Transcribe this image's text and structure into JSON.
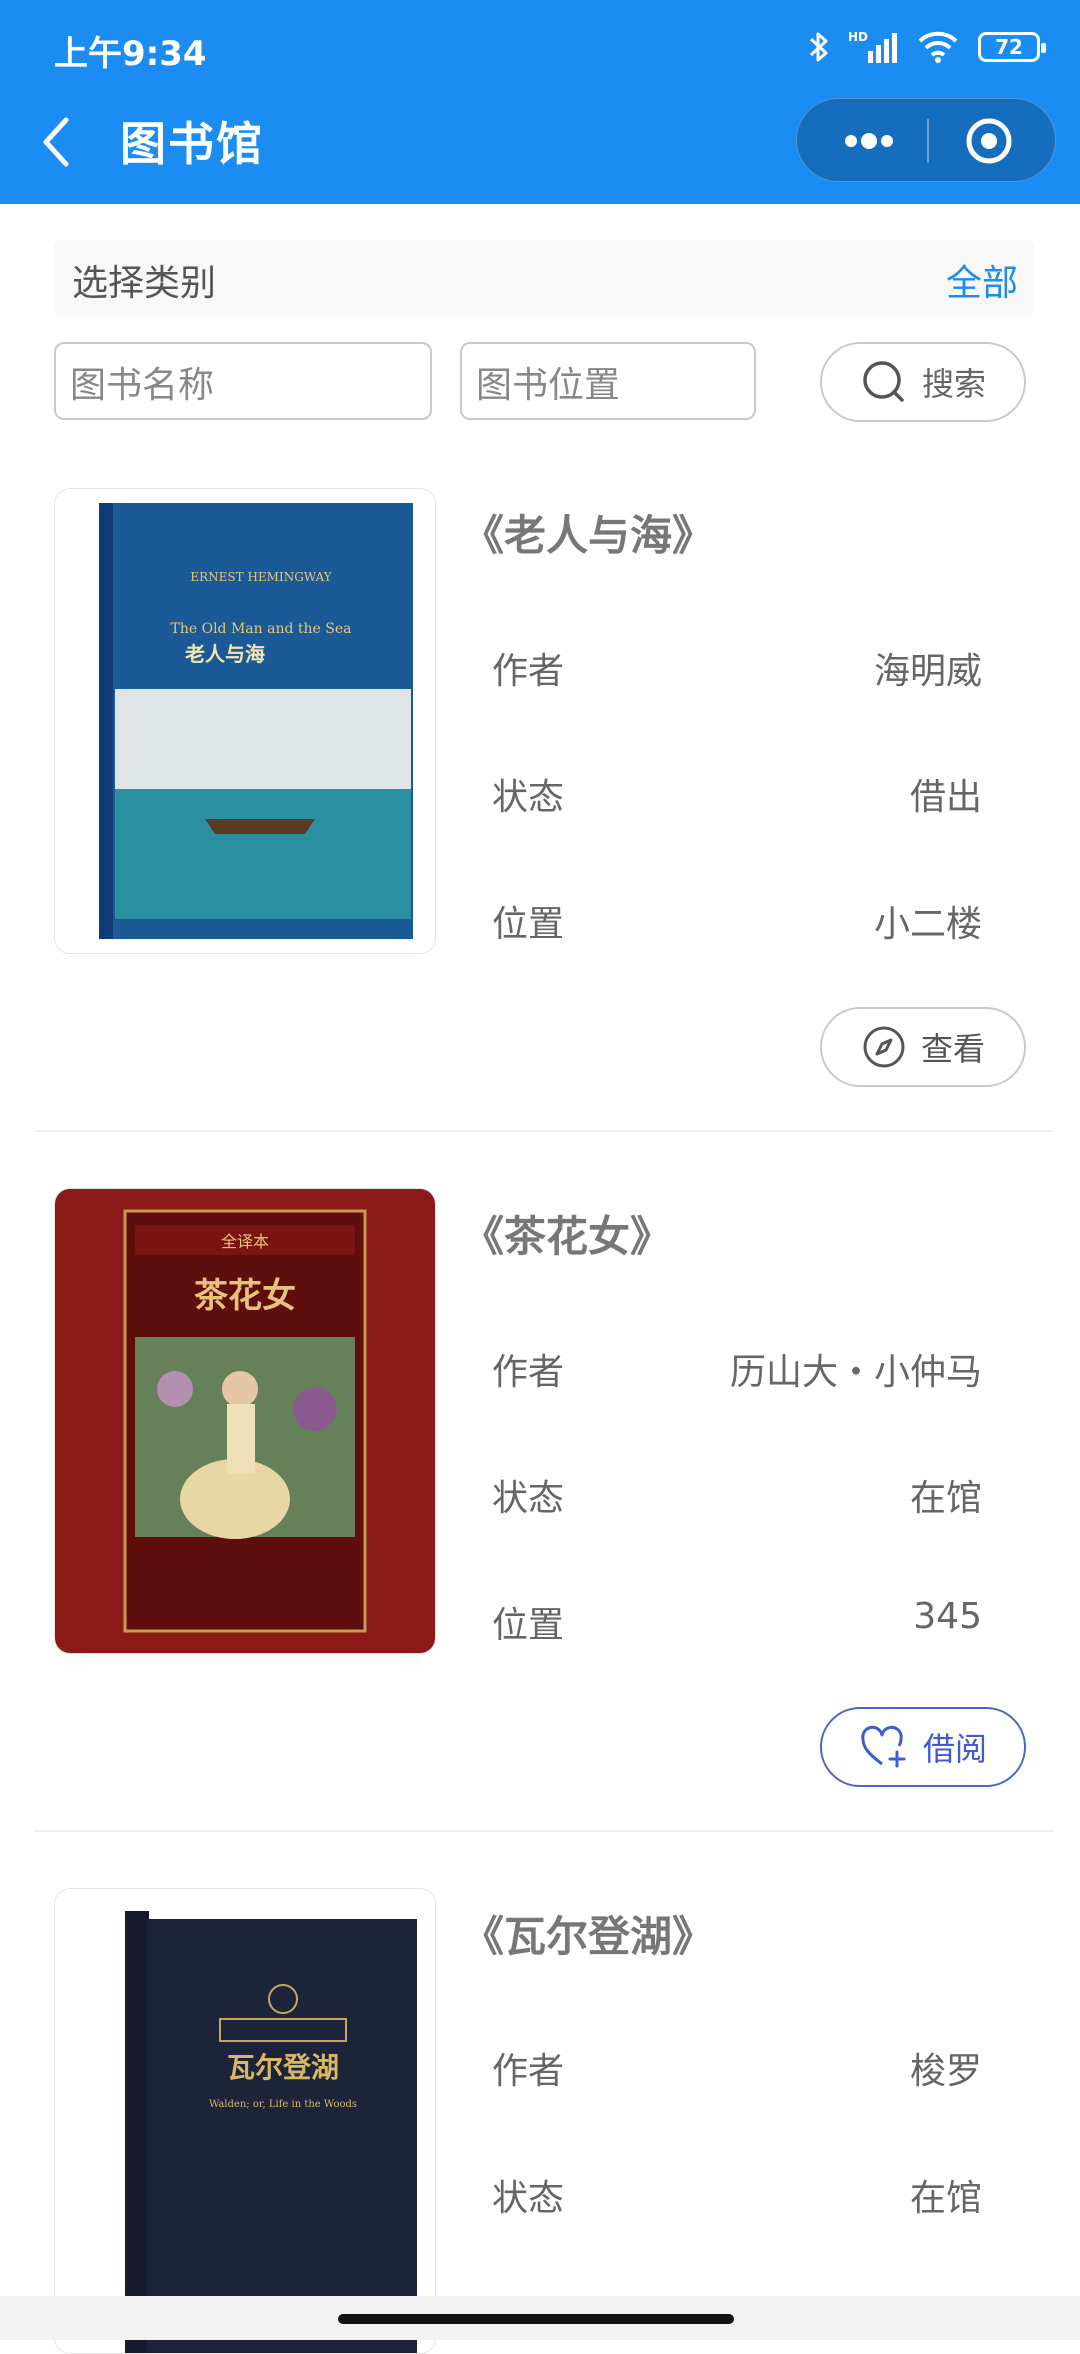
{
  "status_bar": {
    "time": "上午9:34",
    "battery": "72",
    "network": "HD"
  },
  "header": {
    "title": "图书馆"
  },
  "category": {
    "label": "选择类别",
    "value": "全部"
  },
  "search": {
    "name_placeholder": "图书名称",
    "location_placeholder": "图书位置",
    "button_label": "搜索"
  },
  "labels": {
    "author": "作者",
    "status": "状态",
    "location": "位置"
  },
  "books": [
    {
      "title": "《老人与海》",
      "author": "海明威",
      "status": "借出",
      "location": "小二楼",
      "action": "查看",
      "cover": {
        "publisher": "ERNEST HEMINGWAY",
        "en_title": "The Old Man and the Sea",
        "zh_title": "老人与海"
      }
    },
    {
      "title": "《茶花女》",
      "author": "历山大・小仲马",
      "status": "在馆",
      "location": "345",
      "action": "借阅",
      "cover": {
        "top": "全译本",
        "zh_title": "茶花女"
      }
    },
    {
      "title": "《瓦尔登湖》",
      "author": "梭罗",
      "status": "在馆",
      "cover": {
        "zh_title": "瓦尔登湖",
        "en_title": "Walden; or, Life in the Woods"
      }
    }
  ],
  "colors": {
    "header": "#1b8cf2",
    "accent": "#1b8cf2",
    "borrow": "#3f5bd0"
  }
}
